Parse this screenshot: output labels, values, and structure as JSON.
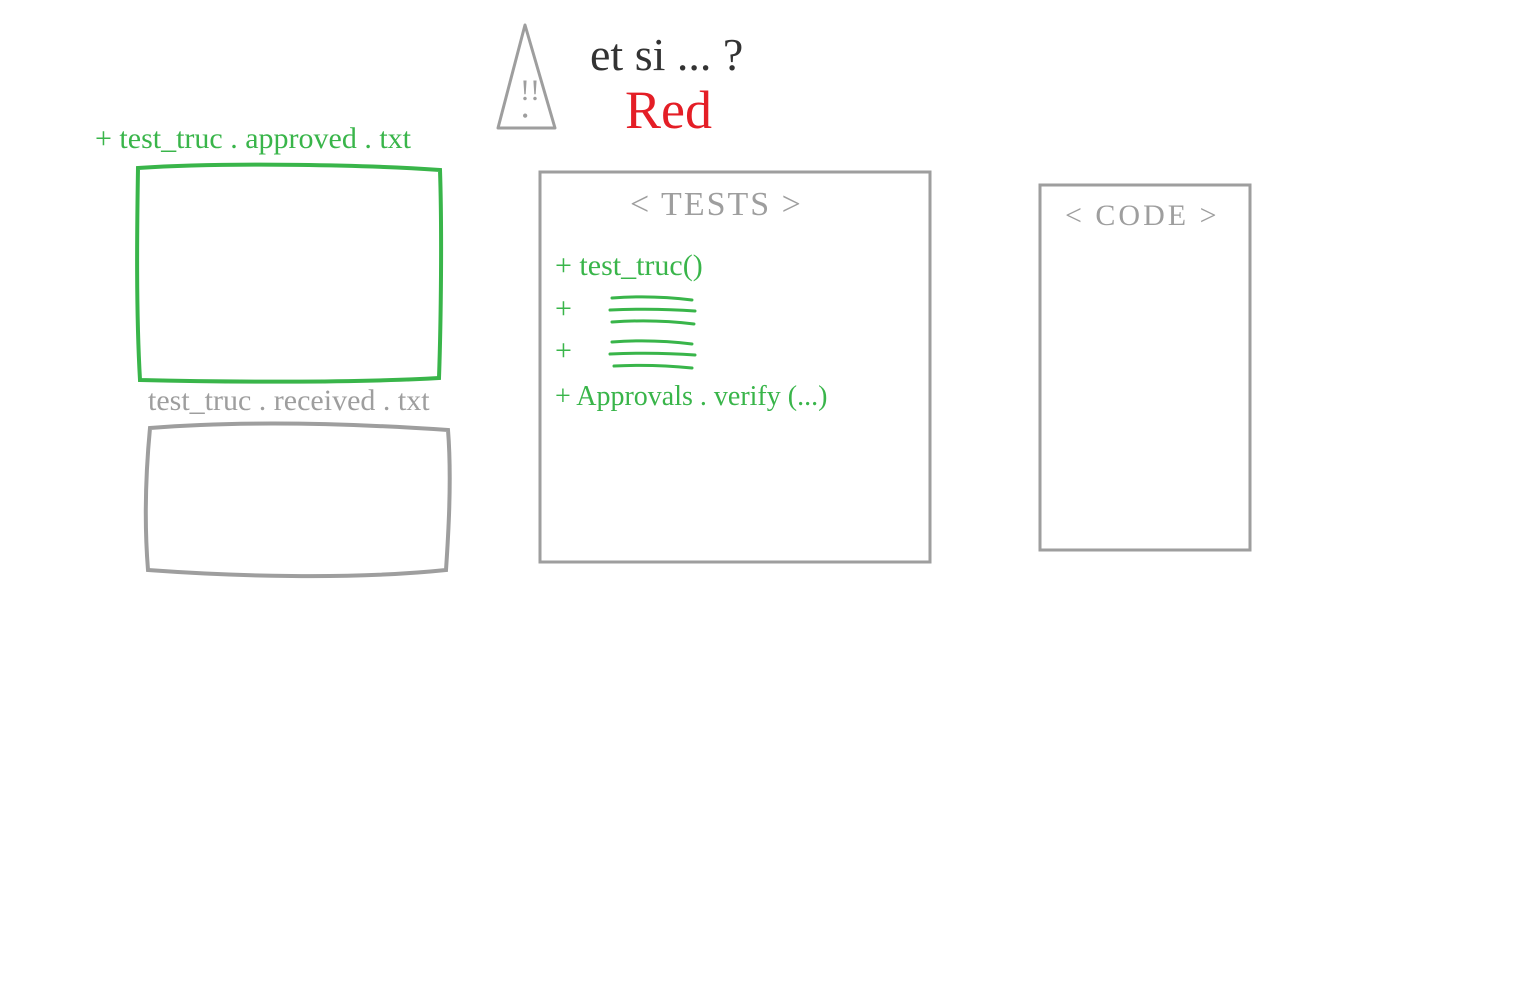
{
  "header": {
    "question": "et si ... ?",
    "phase": "Red",
    "warning_glyph": "!!"
  },
  "files": {
    "approved_label": "+  test_truc . approved . txt",
    "received_label": "test_truc . received . txt"
  },
  "tests_box": {
    "title": "< TESTS >",
    "lines": [
      "+ test_truc()",
      "+",
      "+",
      "+  Approvals . verify (...)"
    ]
  },
  "code_box": {
    "title": "< CODE >"
  },
  "colors": {
    "green": "#39b54a",
    "grey": "#9e9e9e",
    "red": "#e41e26",
    "black": "#333333"
  }
}
